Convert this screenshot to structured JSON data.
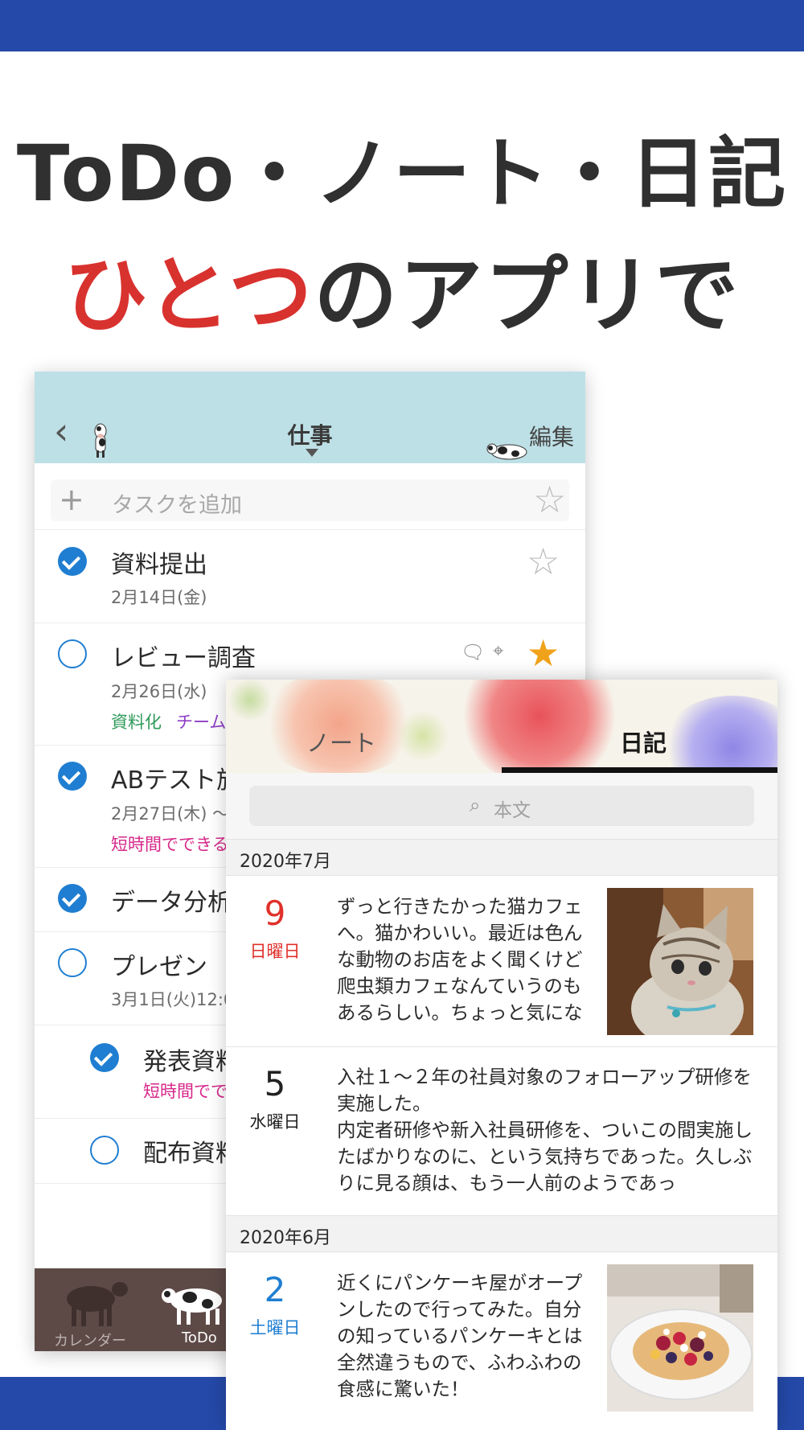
{
  "headline": {
    "line1": "ToDo・ノート・日記",
    "line2_highlight": "ひとつ",
    "line2_rest": "のアプリで"
  },
  "todo_app": {
    "list_title": "仕事",
    "edit_label": "編集",
    "add_placeholder": "タスクを追加",
    "tasks": [
      {
        "title": "資料提出",
        "date": "2月14日(金)",
        "done": true,
        "starred": false
      },
      {
        "title": "レビュー調査",
        "date": "2月26日(水)",
        "tags": [
          "資料化",
          "チーム"
        ],
        "done": false,
        "starred": true
      },
      {
        "title": "ABテスト施",
        "date": "2月27日(木) ～",
        "note": "短時間でできる",
        "done": true
      },
      {
        "title": "データ分析",
        "done": true
      },
      {
        "title": "プレゼン",
        "date": "3月1日(火)12:0",
        "done": false
      },
      {
        "title": "発表資料",
        "note": "短時間でで",
        "done": true,
        "subtask": true
      },
      {
        "title": "配布資料",
        "done": false,
        "subtask": true
      }
    ],
    "tabs": [
      {
        "label": "カレンダー",
        "icon": "cow-silhouette-icon"
      },
      {
        "label": "ToDo",
        "icon": "cow-icon"
      }
    ]
  },
  "diary_app": {
    "segments": [
      "ノート",
      "日記"
    ],
    "active_segment": "日記",
    "search_placeholder": "本文",
    "months": [
      {
        "label": "2020年7月",
        "entries": [
          {
            "day": "9",
            "weekday": "日曜日",
            "color": "#e0302a",
            "has_photo": true,
            "photo": "cat",
            "text": "ずっと行きたかった猫カフェへ。猫かわいい。最近は色んな動物のお店をよく聞くけど爬虫類カフェなんていうのもあるらしい。ちょっと気にな"
          },
          {
            "day": "5",
            "weekday": "水曜日",
            "color": "#222222",
            "has_photo": false,
            "text": "入社１～２年の社員対象のフォローアップ研修を実施した。",
            "text2": "内定者研修や新入社員研修を、ついこの間実施したばかりなのに、という気持ちであった。久しぶりに見る顔は、もう一人前のようであっ"
          }
        ]
      },
      {
        "label": "2020年6月",
        "entries": [
          {
            "day": "2",
            "weekday": "土曜日",
            "color": "#1f7ed1",
            "has_photo": true,
            "photo": "pancake",
            "text": "近くにパンケーキ屋がオープンしたので行ってみた。自分の知っているパンケーキとは全然違うもので、ふわふわの食感に驚いた！"
          }
        ]
      }
    ]
  },
  "colors": {
    "brand_blue": "#2449a8",
    "highlight_red": "#d8322f",
    "check_blue": "#1f7ed1",
    "star_gold": "#f0a21a",
    "header_teal": "#bde0e6",
    "tag_green": "#2e9a5a",
    "tag_purple": "#8e3fc6",
    "note_pink": "#d6288a"
  }
}
